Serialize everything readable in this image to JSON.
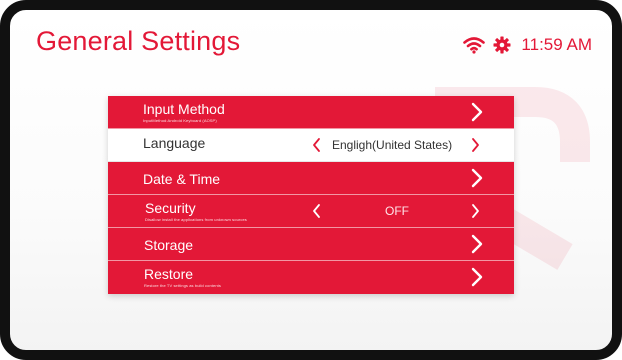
{
  "header": {
    "title": "General Settings",
    "time": "11:59 AM"
  },
  "colors": {
    "accent": "#e31837",
    "active_bg": "#ffffff"
  },
  "icons": [
    "wifi-icon",
    "gear-icon",
    "chevron-right-icon",
    "chevron-left-icon"
  ],
  "menu": {
    "items": [
      {
        "label": "Input Method",
        "sublabel": "InputMethod:Android Keyboard (AOSP)",
        "control": "chevron"
      },
      {
        "label": "Language",
        "value": "Engligh(United States)",
        "control": "selector",
        "active": true
      },
      {
        "label": "Date & Time",
        "control": "chevron"
      },
      {
        "label": "Security",
        "sublabel": "Disallow install the applications from unknown sources",
        "value": "OFF",
        "control": "selector"
      },
      {
        "label": "Storage",
        "control": "chevron"
      },
      {
        "label": "Restore",
        "sublabel": "Restore the TV settings as build contents",
        "control": "chevron"
      }
    ]
  }
}
